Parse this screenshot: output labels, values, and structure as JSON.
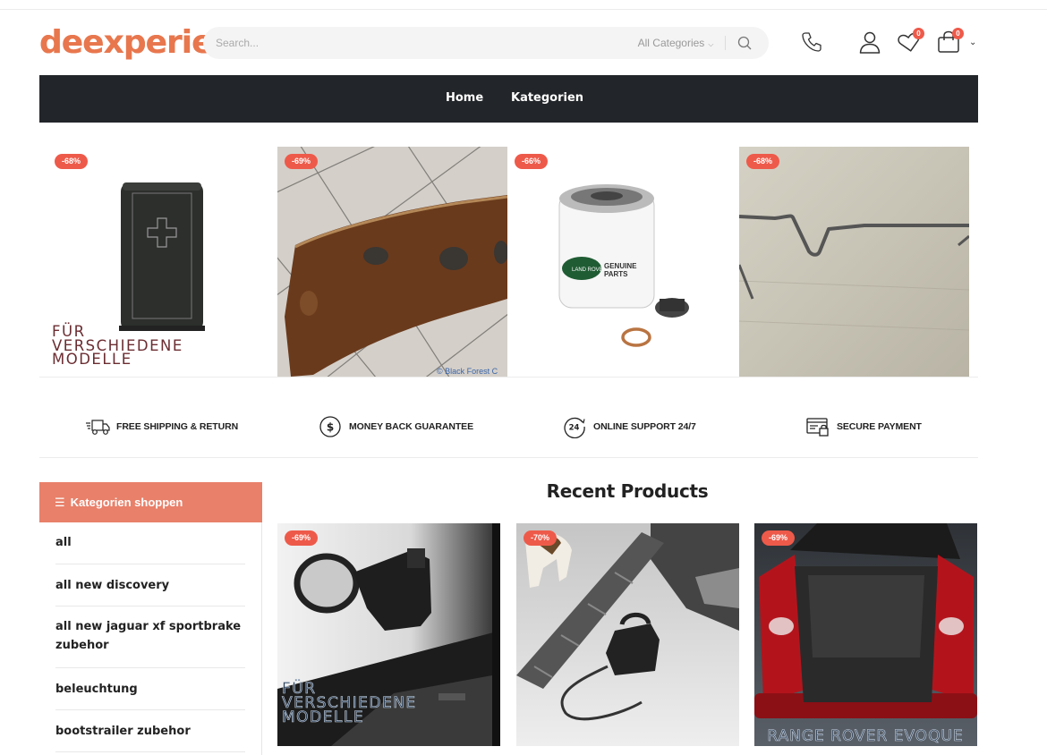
{
  "brand": {
    "logo_text": "deexperienc",
    "accent_color": "#e8774e"
  },
  "search": {
    "placeholder": "Search...",
    "category_label": "All Categories",
    "button_icon": "search-icon"
  },
  "header_icons": {
    "phone_icon": "phone-icon",
    "account_icon": "user-icon",
    "wishlist_icon": "heart-icon",
    "wishlist_count": "0",
    "cart_icon": "shopping-bag-icon",
    "cart_count": "0"
  },
  "nav": {
    "items": [
      {
        "label": "Home"
      },
      {
        "label": "Kategorien"
      }
    ]
  },
  "banners": [
    {
      "discount": "-68%",
      "text_lines": [
        "FÜR",
        "VERSCHIEDENE",
        "MODELLE"
      ]
    },
    {
      "discount": "-69%",
      "watermark": "© Black Forest C"
    },
    {
      "discount": "-66%",
      "label_lines": [
        "GENUINE",
        "PARTS"
      ]
    },
    {
      "discount": "-68%"
    }
  ],
  "features": [
    {
      "label": "FREE SHIPPING & RETURN",
      "icon": "truck-icon"
    },
    {
      "label": "MONEY BACK GUARANTEE",
      "icon": "dollar-icon"
    },
    {
      "label": "ONLINE SUPPORT 24/7",
      "icon": "support-24-icon"
    },
    {
      "label": "SECURE PAYMENT",
      "icon": "secure-payment-icon"
    }
  ],
  "sidebar": {
    "title": "Kategorien shoppen",
    "items": [
      {
        "label": "all"
      },
      {
        "label": "all new discovery"
      },
      {
        "label": "all new jaguar xf sportbrake zubehor"
      },
      {
        "label": "beleuchtung"
      },
      {
        "label": "bootstrailer zubehor"
      }
    ]
  },
  "recent": {
    "title": "Recent Products",
    "products": [
      {
        "discount": "-69%",
        "text_lines": [
          "FÜR",
          "VERSCHIEDENE",
          "MODELLE"
        ]
      },
      {
        "discount": "-70%"
      },
      {
        "discount": "-69%",
        "caption": "RANGE ROVER EVOQUE"
      }
    ]
  },
  "colors": {
    "nav_bg": "#222529",
    "sidebar_head_bg": "#e8806a",
    "badge_red": "#ee5a4a"
  }
}
